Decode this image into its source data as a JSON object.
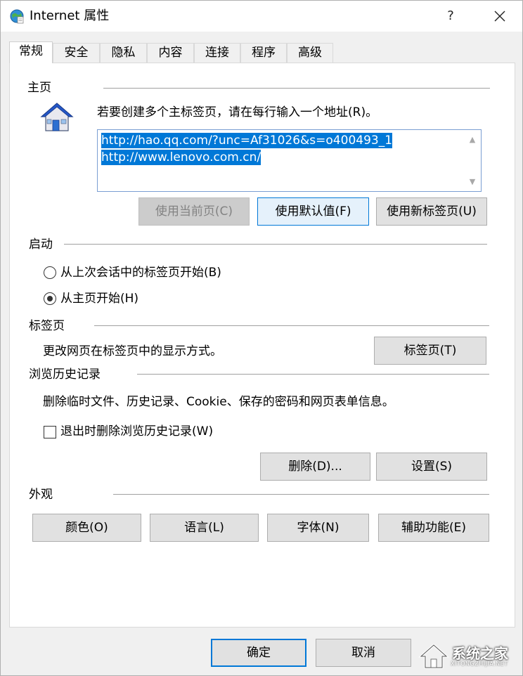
{
  "window": {
    "title": "Internet 属性",
    "help_label": "?",
    "icon": "internet-globe-icon",
    "close_icon": "close-icon"
  },
  "tabs": [
    {
      "label": "常规",
      "active": true
    },
    {
      "label": "安全"
    },
    {
      "label": "隐私"
    },
    {
      "label": "内容"
    },
    {
      "label": "连接"
    },
    {
      "label": "程序"
    },
    {
      "label": "高级"
    }
  ],
  "home": {
    "group_label": "主页",
    "icon": "house-icon",
    "instruction": "若要创建多个主标签页，请在每行输入一个地址(R)。",
    "urls": [
      "http://hao.qq.com/?unc=Af31026&s=o400493_1",
      "http://www.lenovo.com.cn/"
    ],
    "buttons": {
      "use_current": "使用当前页(C)",
      "use_default": "使用默认值(F)",
      "use_new_tab": "使用新标签页(U)"
    }
  },
  "startup": {
    "group_label": "启动",
    "options": [
      {
        "label": "从上次会话中的标签页开始(B)",
        "checked": false
      },
      {
        "label": "从主页开始(H)",
        "checked": true
      }
    ]
  },
  "tabs_section": {
    "group_label": "标签页",
    "description": "更改网页在标签页中的显示方式。",
    "button": "标签页(T)"
  },
  "history": {
    "group_label": "浏览历史记录",
    "description": "删除临时文件、历史记录、Cookie、保存的密码和网页表单信息。",
    "checkbox_label": "退出时删除浏览历史记录(W)",
    "checkbox_checked": false,
    "delete_button": "删除(D)...",
    "settings_button": "设置(S)"
  },
  "appearance": {
    "group_label": "外观",
    "buttons": [
      "颜色(O)",
      "语言(L)",
      "字体(N)",
      "辅助功能(E)"
    ]
  },
  "footer": {
    "ok": "确定",
    "cancel": "取消"
  },
  "watermark": {
    "text": "系统之家",
    "sub": "XITONGZHIJIA.NET"
  },
  "colors": {
    "accent": "#0078d7",
    "selection": "#0078d7",
    "panel_bg": "#ffffff",
    "window_bg": "#f0f0f0"
  }
}
